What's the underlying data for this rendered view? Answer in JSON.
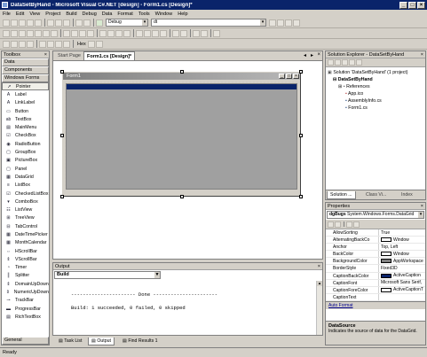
{
  "window": {
    "title": "DataSetByHand - Microsoft Visual C#.NET [design] - Form1.cs [Design]*"
  },
  "menu": [
    "File",
    "Edit",
    "View",
    "Project",
    "Build",
    "Debug",
    "Data",
    "Format",
    "Tools",
    "Window",
    "Help"
  ],
  "toolbar": {
    "config": "Debug",
    "find_value": "dt"
  },
  "toolbar3": {
    "hex_label": "Hex"
  },
  "toolbox": {
    "title": "Toolbox",
    "cat_data": "Data",
    "cat_components": "Components",
    "cat_winforms": "Windows Forms",
    "cat_general": "General",
    "items": [
      "Pointer",
      "Label",
      "LinkLabel",
      "Button",
      "TextBox",
      "MainMenu",
      "CheckBox",
      "RadioButton",
      "GroupBox",
      "PictureBox",
      "Panel",
      "DataGrid",
      "ListBox",
      "CheckedListBox",
      "ComboBox",
      "ListView",
      "TreeView",
      "TabControl",
      "DateTimePicker",
      "MonthCalendar",
      "HScrollBar",
      "VScrollBar",
      "Timer",
      "Splitter",
      "DomainUpDown",
      "NumericUpDown",
      "TrackBar",
      "ProgressBar",
      "RichTextBox"
    ],
    "icons": [
      "pointer-icon",
      "label-icon",
      "linklabel-icon",
      "button-icon",
      "textbox-icon",
      "mainmenu-icon",
      "checkbox-icon",
      "radiobutton-icon",
      "groupbox-icon",
      "picturebox-icon",
      "panel-icon",
      "datagrid-icon",
      "listbox-icon",
      "checkedlistbox-icon",
      "combobox-icon",
      "listview-icon",
      "treeview-icon",
      "tabcontrol-icon",
      "datetimepicker-icon",
      "monthcalendar-icon",
      "hscrollbar-icon",
      "vscrollbar-icon",
      "timer-icon",
      "splitter-icon",
      "domainupdown-icon",
      "numericupdown-icon",
      "trackbar-icon",
      "progressbar-icon",
      "richtextbox-icon"
    ]
  },
  "doc_tabs": {
    "start_page": "Start Page",
    "form1": "Form1.cs [Design]*"
  },
  "designer": {
    "form_title": "Form1"
  },
  "solution": {
    "title": "Solution Explorer - DataSetByHand",
    "solution_label": "Solution 'DataSetByHand' (1 project)",
    "project": "DataSetByHand",
    "references": "References",
    "app_ico": "App.ico",
    "assembly_info": "AssemblyInfo.cs",
    "form1": "Form1.cs",
    "tabs": [
      "Solution ...",
      "Class Vi...",
      "Index"
    ]
  },
  "properties": {
    "title": "Properties",
    "object_name": "dgBugs",
    "object_type": "System.Windows.Forms.DataGrid",
    "rows": [
      {
        "name": "AllowSorting",
        "value": "True",
        "swatch": ""
      },
      {
        "name": "AlternatingBackCo",
        "value": "Window",
        "swatch": "#ffffff"
      },
      {
        "name": "Anchor",
        "value": "Top, Left",
        "swatch": ""
      },
      {
        "name": "BackColor",
        "value": "Window",
        "swatch": "#ffffff"
      },
      {
        "name": "BackgroundColor",
        "value": "AppWorkspace",
        "swatch": "#808080"
      },
      {
        "name": "BorderStyle",
        "value": "Fixed3D",
        "swatch": ""
      },
      {
        "name": "CaptionBackColor",
        "value": "ActiveCaption",
        "swatch": "#0a246a"
      },
      {
        "name": "CaptionFont",
        "value": "Microsoft Sans Serif,",
        "swatch": ""
      },
      {
        "name": "CaptionForeColor",
        "value": "ActiveCaptionT",
        "swatch": "#ffffff"
      },
      {
        "name": "CaptionText",
        "value": "",
        "swatch": ""
      }
    ],
    "auto_format": "Auto Format",
    "desc_title": "DataSource",
    "desc_text": "Indicates the source of data for the DataGrid."
  },
  "output": {
    "title": "Output",
    "pane": "Build",
    "done_line": "---------------------- Done ----------------------",
    "result_line": "Build: 1 succeeded, 0 failed, 0 skipped"
  },
  "bottom_tabs": [
    "Task List",
    "Output",
    "Find Results 1"
  ],
  "status": {
    "text": "Ready"
  },
  "colors": {
    "title_bar": "#0a246a",
    "chrome": "#d4d0c8",
    "form_client": "#a0a0a0"
  }
}
